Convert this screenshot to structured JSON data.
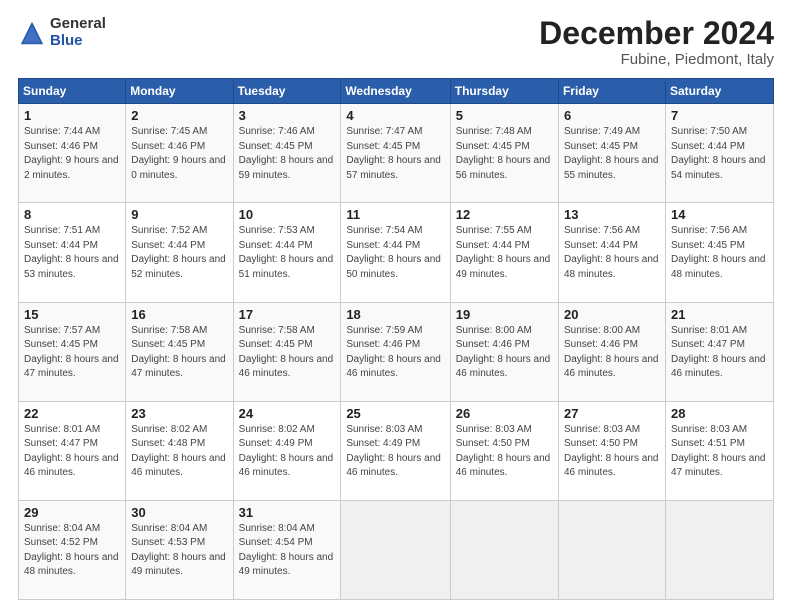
{
  "logo": {
    "general": "General",
    "blue": "Blue"
  },
  "title": "December 2024",
  "subtitle": "Fubine, Piedmont, Italy",
  "days_header": [
    "Sunday",
    "Monday",
    "Tuesday",
    "Wednesday",
    "Thursday",
    "Friday",
    "Saturday"
  ],
  "weeks": [
    [
      {
        "day": "1",
        "sunrise": "7:44 AM",
        "sunset": "4:46 PM",
        "daylight": "9 hours and 2 minutes."
      },
      {
        "day": "2",
        "sunrise": "7:45 AM",
        "sunset": "4:46 PM",
        "daylight": "9 hours and 0 minutes."
      },
      {
        "day": "3",
        "sunrise": "7:46 AM",
        "sunset": "4:45 PM",
        "daylight": "8 hours and 59 minutes."
      },
      {
        "day": "4",
        "sunrise": "7:47 AM",
        "sunset": "4:45 PM",
        "daylight": "8 hours and 57 minutes."
      },
      {
        "day": "5",
        "sunrise": "7:48 AM",
        "sunset": "4:45 PM",
        "daylight": "8 hours and 56 minutes."
      },
      {
        "day": "6",
        "sunrise": "7:49 AM",
        "sunset": "4:45 PM",
        "daylight": "8 hours and 55 minutes."
      },
      {
        "day": "7",
        "sunrise": "7:50 AM",
        "sunset": "4:44 PM",
        "daylight": "8 hours and 54 minutes."
      }
    ],
    [
      {
        "day": "8",
        "sunrise": "7:51 AM",
        "sunset": "4:44 PM",
        "daylight": "8 hours and 53 minutes."
      },
      {
        "day": "9",
        "sunrise": "7:52 AM",
        "sunset": "4:44 PM",
        "daylight": "8 hours and 52 minutes."
      },
      {
        "day": "10",
        "sunrise": "7:53 AM",
        "sunset": "4:44 PM",
        "daylight": "8 hours and 51 minutes."
      },
      {
        "day": "11",
        "sunrise": "7:54 AM",
        "sunset": "4:44 PM",
        "daylight": "8 hours and 50 minutes."
      },
      {
        "day": "12",
        "sunrise": "7:55 AM",
        "sunset": "4:44 PM",
        "daylight": "8 hours and 49 minutes."
      },
      {
        "day": "13",
        "sunrise": "7:56 AM",
        "sunset": "4:44 PM",
        "daylight": "8 hours and 48 minutes."
      },
      {
        "day": "14",
        "sunrise": "7:56 AM",
        "sunset": "4:45 PM",
        "daylight": "8 hours and 48 minutes."
      }
    ],
    [
      {
        "day": "15",
        "sunrise": "7:57 AM",
        "sunset": "4:45 PM",
        "daylight": "8 hours and 47 minutes."
      },
      {
        "day": "16",
        "sunrise": "7:58 AM",
        "sunset": "4:45 PM",
        "daylight": "8 hours and 47 minutes."
      },
      {
        "day": "17",
        "sunrise": "7:58 AM",
        "sunset": "4:45 PM",
        "daylight": "8 hours and 46 minutes."
      },
      {
        "day": "18",
        "sunrise": "7:59 AM",
        "sunset": "4:46 PM",
        "daylight": "8 hours and 46 minutes."
      },
      {
        "day": "19",
        "sunrise": "8:00 AM",
        "sunset": "4:46 PM",
        "daylight": "8 hours and 46 minutes."
      },
      {
        "day": "20",
        "sunrise": "8:00 AM",
        "sunset": "4:46 PM",
        "daylight": "8 hours and 46 minutes."
      },
      {
        "day": "21",
        "sunrise": "8:01 AM",
        "sunset": "4:47 PM",
        "daylight": "8 hours and 46 minutes."
      }
    ],
    [
      {
        "day": "22",
        "sunrise": "8:01 AM",
        "sunset": "4:47 PM",
        "daylight": "8 hours and 46 minutes."
      },
      {
        "day": "23",
        "sunrise": "8:02 AM",
        "sunset": "4:48 PM",
        "daylight": "8 hours and 46 minutes."
      },
      {
        "day": "24",
        "sunrise": "8:02 AM",
        "sunset": "4:49 PM",
        "daylight": "8 hours and 46 minutes."
      },
      {
        "day": "25",
        "sunrise": "8:03 AM",
        "sunset": "4:49 PM",
        "daylight": "8 hours and 46 minutes."
      },
      {
        "day": "26",
        "sunrise": "8:03 AM",
        "sunset": "4:50 PM",
        "daylight": "8 hours and 46 minutes."
      },
      {
        "day": "27",
        "sunrise": "8:03 AM",
        "sunset": "4:50 PM",
        "daylight": "8 hours and 46 minutes."
      },
      {
        "day": "28",
        "sunrise": "8:03 AM",
        "sunset": "4:51 PM",
        "daylight": "8 hours and 47 minutes."
      }
    ],
    [
      {
        "day": "29",
        "sunrise": "8:04 AM",
        "sunset": "4:52 PM",
        "daylight": "8 hours and 48 minutes."
      },
      {
        "day": "30",
        "sunrise": "8:04 AM",
        "sunset": "4:53 PM",
        "daylight": "8 hours and 49 minutes."
      },
      {
        "day": "31",
        "sunrise": "8:04 AM",
        "sunset": "4:54 PM",
        "daylight": "8 hours and 49 minutes."
      },
      null,
      null,
      null,
      null
    ]
  ]
}
